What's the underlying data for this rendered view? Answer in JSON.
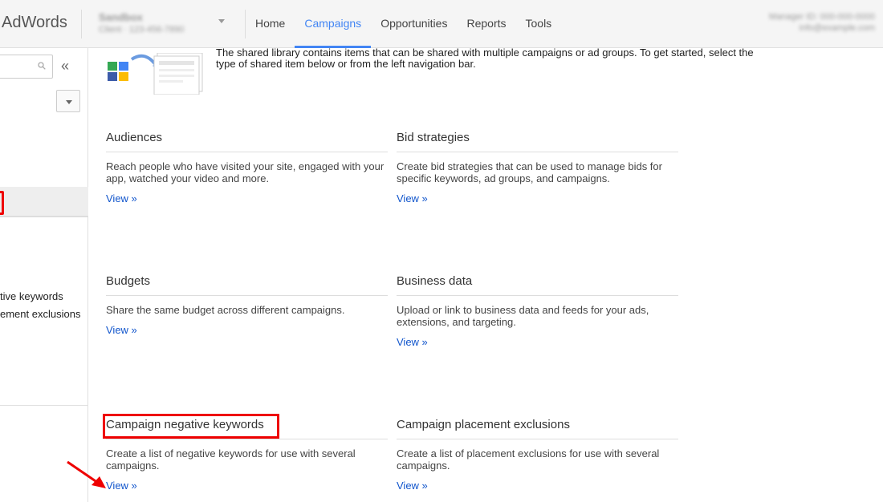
{
  "header": {
    "logo": "AdWords",
    "account_name": "Sandbox",
    "account_sub": "Client · 123-456-7890",
    "user_line1": "Manager ID: 000-000-0000",
    "user_line2": "info@example.com",
    "nav": [
      "Home",
      "Campaigns",
      "Opportunities",
      "Reports",
      "Tools"
    ],
    "active_nav": "Campaigns"
  },
  "sidebar": {
    "collapse_glyph": "«",
    "partial_links": [
      "tive keywords",
      "ement exclusions"
    ]
  },
  "intro": {
    "text": "The shared library contains items that can be shared with multiple campaigns or ad groups. To get started, select the type of shared item below or from the left navigation bar."
  },
  "cards": [
    {
      "title": "Audiences",
      "desc": "Reach people who have visited your site, engaged with your app, watched your video and more.",
      "link": "View »"
    },
    {
      "title": "Bid strategies",
      "desc": "Create bid strategies that can be used to manage bids for specific keywords, ad groups, and campaigns.",
      "link": "View »"
    },
    {
      "title": "Budgets",
      "desc": "Share the same budget across different campaigns.",
      "link": "View »"
    },
    {
      "title": "Business data",
      "desc": "Upload or link to business data and feeds for your ads, extensions, and targeting.",
      "link": "View »"
    },
    {
      "title": "Campaign negative keywords",
      "desc": "Create a list of negative keywords for use with several campaigns.",
      "link": "View »"
    },
    {
      "title": "Campaign placement exclusions",
      "desc": "Create a list of placement exclusions for use with several campaigns.",
      "link": "View »"
    }
  ],
  "colors": {
    "accent": "#4285f4",
    "link": "#1155cc",
    "annotation": "#ee0000"
  }
}
